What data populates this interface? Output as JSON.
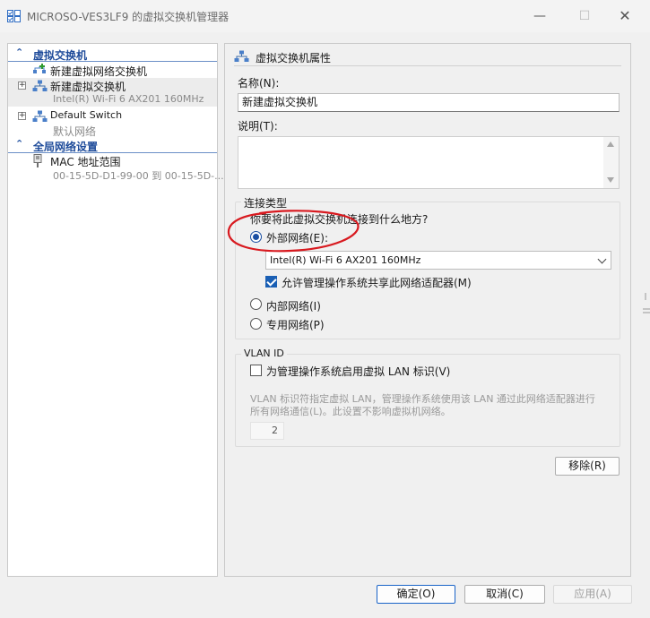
{
  "window": {
    "title": "MICROSO-VES3LF9 的虚拟交换机管理器",
    "controls": {
      "minimize": "—",
      "maximize": "☐",
      "close": "✕"
    }
  },
  "tree": {
    "sections": {
      "virtual_switches": "虚拟交换机",
      "global_network": "全局网络设置"
    },
    "items": [
      {
        "label": "新建虚拟网络交换机",
        "sub": ""
      },
      {
        "label": "新建虚拟交换机",
        "sub": "Intel(R) Wi-Fi 6 AX201 160MHz",
        "expander": "+"
      },
      {
        "label": "Default Switch",
        "sub": "默认网络",
        "expander": "+"
      },
      {
        "label": "MAC 地址范围",
        "sub": "00-15-5D-D1-99-00 到 00-15-5D-..."
      }
    ]
  },
  "panel": {
    "title": "虚拟交换机属性",
    "name_label": "名称(N):",
    "name_value": "新建虚拟交换机",
    "notes_label": "说明(T):",
    "connection": {
      "legend": "连接类型",
      "question": "你要将此虚拟交换机连接到什么地方?",
      "external_label": "外部网络(E):",
      "external_selected": true,
      "adapter_value": "Intel(R) Wi-Fi 6 AX201 160MHz",
      "allow_share_label": "允许管理操作系统共享此网络适配器(M)",
      "allow_share_checked": true,
      "internal_label": "内部网络(I)",
      "private_label": "专用网络(P)"
    },
    "vlan": {
      "legend": "VLAN ID",
      "enable_label": "为管理操作系统启用虚拟 LAN 标识(V)",
      "enable_checked": false,
      "description_line1": "VLAN 标识符指定虚拟 LAN，管理操作系统使用该 LAN 通过此网络适配器进行",
      "description_line2": "所有网络通信(L)。此设置不影响虚拟机网络。",
      "value": "2"
    },
    "remove_button": "移除(R)"
  },
  "footer": {
    "ok": "确定(O)",
    "cancel": "取消(C)",
    "apply": "应用(A)"
  },
  "colors": {
    "accent": "#1a4fa3",
    "section_header": "#1e4b9a",
    "annotation": "#d8191f"
  }
}
